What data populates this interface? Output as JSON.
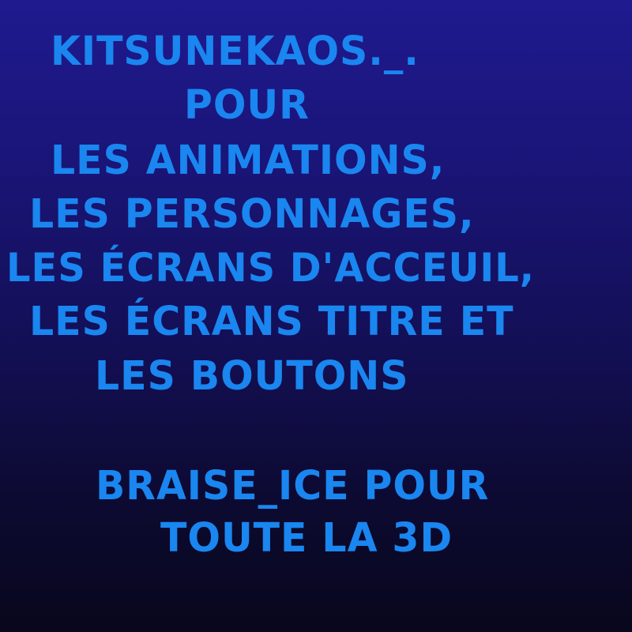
{
  "credits": {
    "lines": [
      "KITSUNEKAOS._.",
      "POUR",
      "LES ANIMATIONS,",
      "LES PERSONNAGES,",
      "LES ÉCRANS D'ACCEUIL,",
      "LES ÉCRANS TITRE ET",
      "LES BOUTONS",
      "BRAISE_ICE POUR",
      "TOUTE LA 3D"
    ]
  },
  "colors": {
    "text": "#1a86f0",
    "background_top": "#1f1a8f",
    "background_bottom": "#08071c"
  }
}
